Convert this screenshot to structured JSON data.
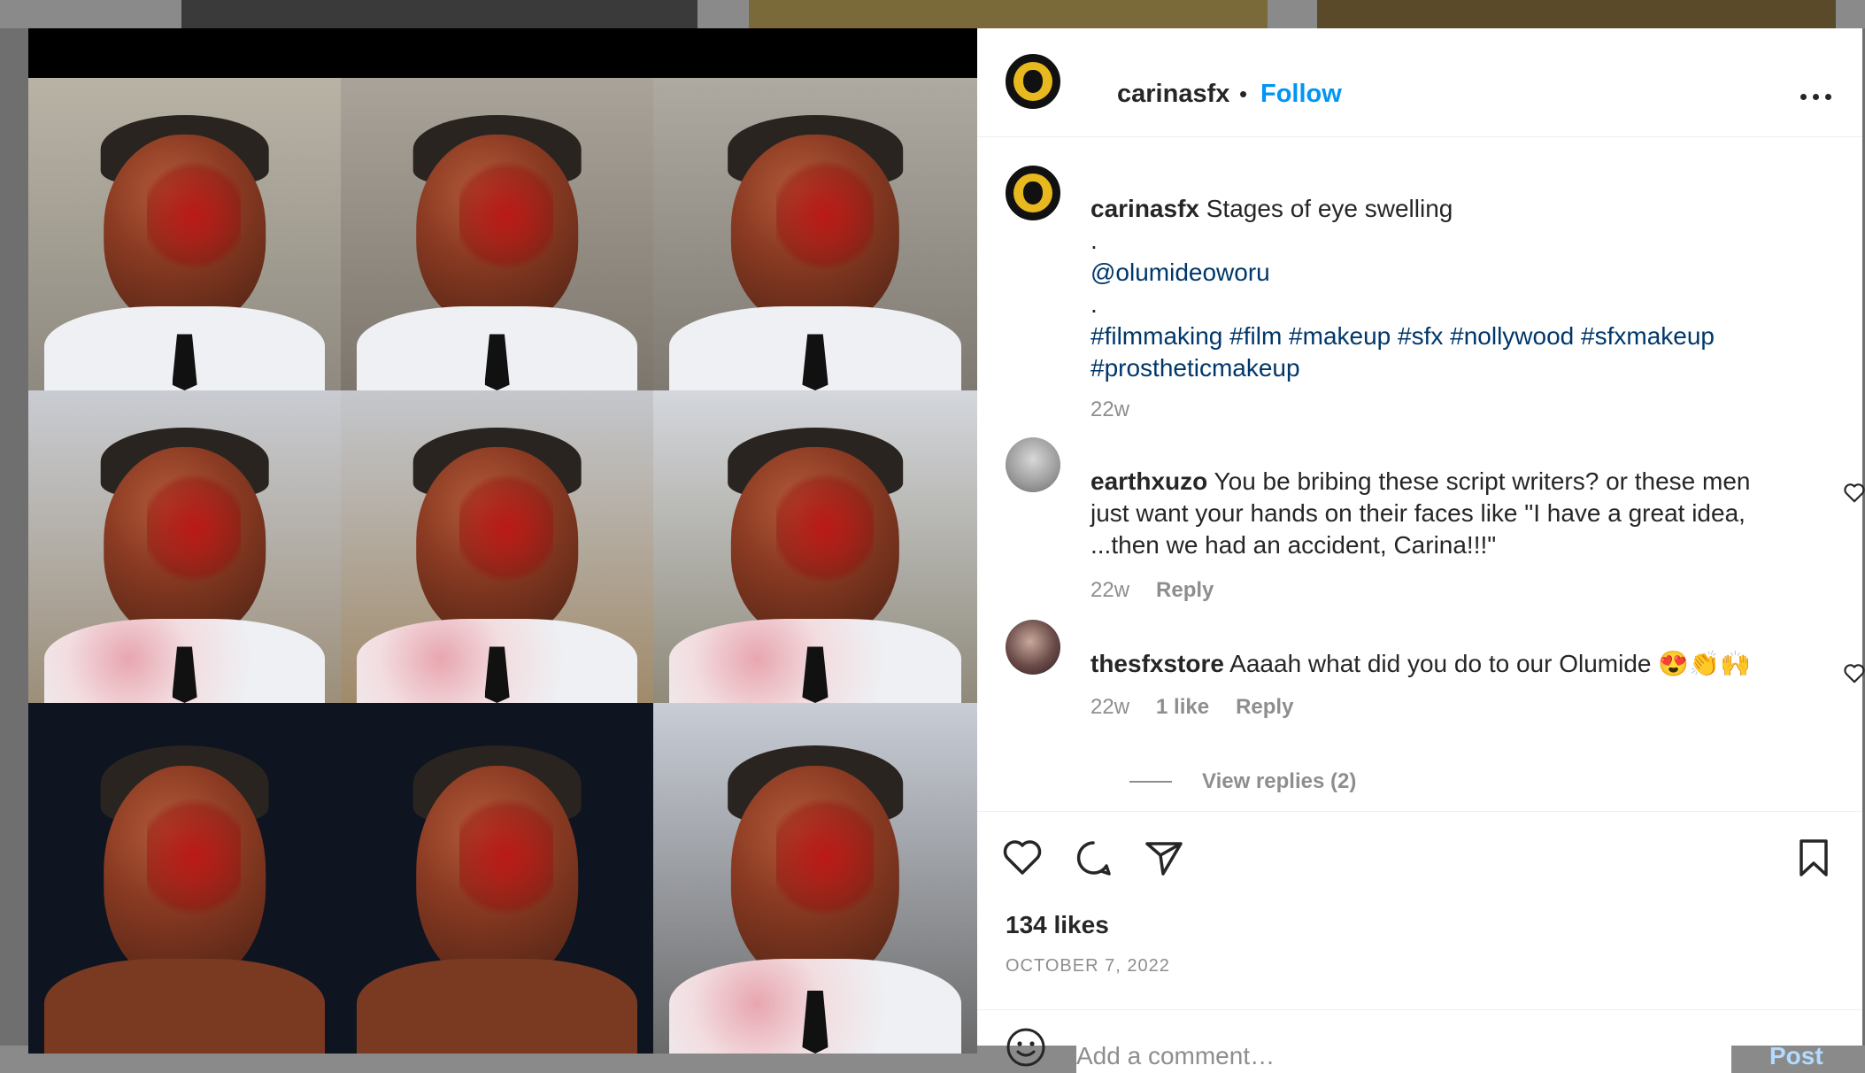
{
  "post": {
    "username": "carinasfx",
    "separator": "•",
    "follow_label": "Follow",
    "more_icon": "more-horizontal-icon",
    "caption": {
      "username": "carinasfx",
      "text": "Stages of eye swelling",
      "dot1": ".",
      "mention": "@olumideoworu",
      "dot2": ".",
      "hashtags_line1": "#filmmaking #film #makeup #sfx #nollywood #sfxmakeup",
      "hashtags_line2": "#prostheticmakeup",
      "age": "22w"
    },
    "comments": [
      {
        "username": "earthxuzo",
        "line1": "You be bribing these script writers? or these men",
        "line2": "just want your hands on their faces like \"I have a great idea,",
        "line3": "...then we had an accident, Carina!!!\"",
        "age": "22w",
        "reply_label": "Reply"
      },
      {
        "username": "thesfxstore",
        "text": "Aaaah what did you do to our Olumide 😍👏🙌",
        "age": "22w",
        "likes_label": "1 like",
        "reply_label": "Reply",
        "view_replies": "View replies (2)"
      }
    ],
    "likes": "134 likes",
    "date": "OCTOBER 7, 2022",
    "add_comment_placeholder": "Add a comment…",
    "post_label": "Post"
  },
  "colors": {
    "accent": "#0095f6",
    "link": "#00376b",
    "muted": "#8e8e8e",
    "text": "#262626",
    "post_disabled": "#b3dbff",
    "logo_gold": "#e8b91f"
  },
  "icons": [
    "heart-icon",
    "comment-icon",
    "share-icon",
    "bookmark-icon",
    "emoji-icon",
    "heart-small-icon"
  ]
}
